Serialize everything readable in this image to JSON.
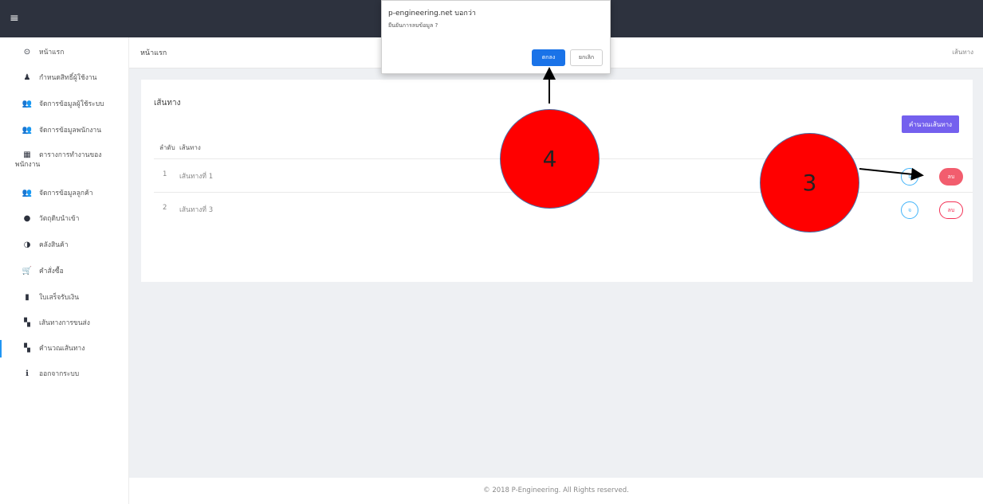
{
  "topbar": {
    "menu_icon": "≡"
  },
  "sidebar": {
    "items": [
      {
        "icon": "clock-icon",
        "glyph": "⊙",
        "label": "หน้าแรก"
      },
      {
        "icon": "user-icon",
        "glyph": "♟",
        "label": "กำหนดสิทธิ์ผู้ใช้งาน"
      },
      {
        "icon": "users-icon",
        "glyph": "👥",
        "label": "จัดการข้อมูลผู้ใช้ระบบ"
      },
      {
        "icon": "users-icon",
        "glyph": "👥",
        "label": "จัดการข้อมูลพนักงาน"
      },
      {
        "icon": "table-icon",
        "glyph": "▦",
        "label": "ตารางการทำงานของ",
        "label2": "พนักงาน"
      },
      {
        "icon": "users-icon",
        "glyph": "👥",
        "label": "จัดการข้อมูลลูกค้า"
      },
      {
        "icon": "product-icon",
        "glyph": "●",
        "label": "วัตถุดิบนำเข้า"
      },
      {
        "icon": "stock-icon",
        "glyph": "◑",
        "label": "คลังสินค้า"
      },
      {
        "icon": "cart-icon",
        "glyph": "🛒",
        "label": "คำสั่งซื้อ"
      },
      {
        "icon": "file-icon",
        "glyph": "▮",
        "label": "ใบเสร็จรับเงิน"
      },
      {
        "icon": "map-icon",
        "glyph": "▚",
        "label": "เส้นทางการขนส่ง"
      },
      {
        "icon": "map-icon",
        "glyph": "▚",
        "label": "คำนวณเส้นทาง"
      },
      {
        "icon": "info-icon",
        "glyph": "ℹ",
        "label": "ออกจากระบบ"
      }
    ]
  },
  "breadcrumb": {
    "left": "หน้าแรก",
    "right": "เส้นทาง"
  },
  "card": {
    "title": "เส้นทาง",
    "calc_button": "คำนวณเส้นทาง",
    "columns": [
      "ลำดับ",
      "เส้นทาง"
    ],
    "rows": [
      {
        "index": "1",
        "name": "เส้นทางที่ 1",
        "edit": "จ",
        "delete": "ลบ"
      },
      {
        "index": "2",
        "name": "เส้นทางที่ 3",
        "edit": "จ",
        "delete": "ลบ"
      }
    ]
  },
  "footer": "© 2018 P-Engineering. All Rights reserved.",
  "dialog": {
    "title": "p-engineering.net บอกว่า",
    "message": "ยืนยันการลบข้อมูล ?",
    "ok": "ตกลง",
    "cancel": "ยกเลิก"
  },
  "annotations": {
    "marker_3": "3",
    "marker_4": "4"
  },
  "colors": {
    "topbar": "#2d323e",
    "accent": "#7460ee",
    "danger": "#f33155",
    "info": "#41b3f9",
    "marker": "#ff0000"
  }
}
